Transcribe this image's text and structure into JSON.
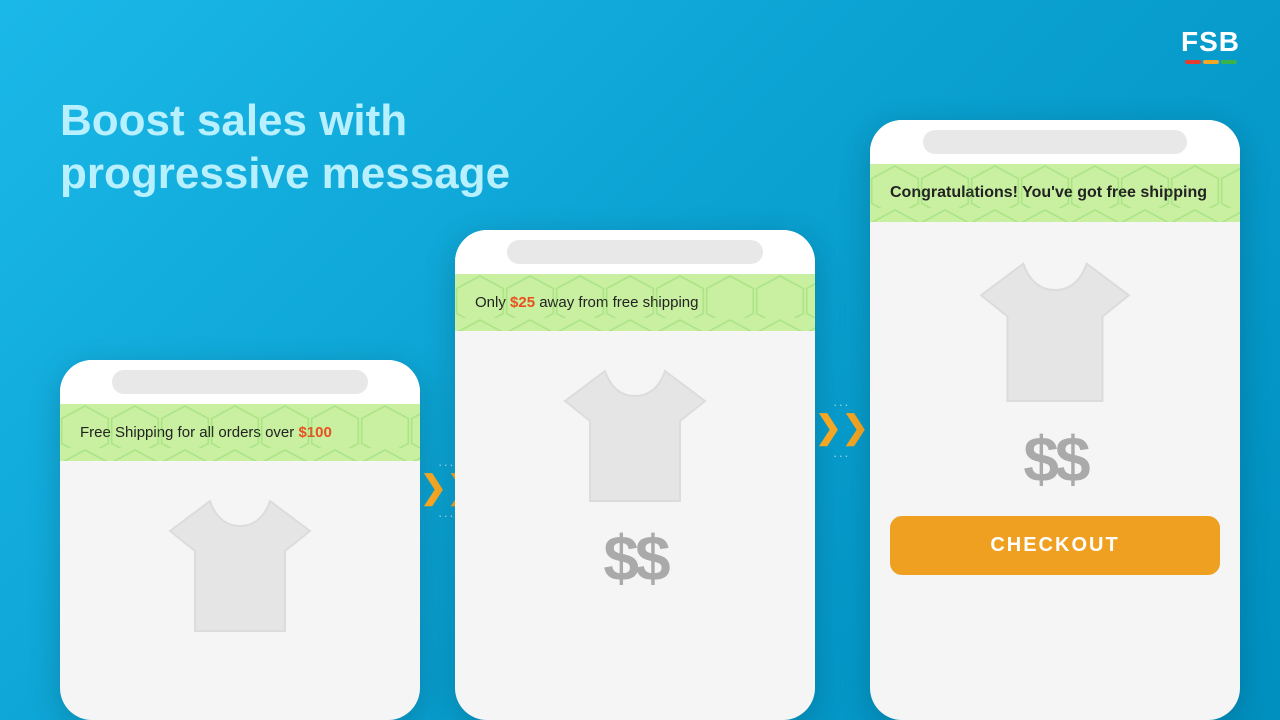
{
  "logo": {
    "text": "FSB",
    "bar_colors": [
      "#e63c2f",
      "#f5a623",
      "#3ab34a"
    ]
  },
  "headline": {
    "line1": "Boost sales with",
    "line2": "progressive message"
  },
  "phone1": {
    "banner_text_before": "Free Shipping for all orders over ",
    "banner_amount": "$100",
    "tshirt_label": "t-shirt product image"
  },
  "phone2": {
    "banner_text_before": "Only ",
    "banner_amount": "$25",
    "banner_text_after": " away from free shipping",
    "tshirt_label": "t-shirt product image",
    "price_label": "$$"
  },
  "phone3": {
    "banner_text": "Congratulations! You've got free shipping",
    "tshirt_label": "t-shirt product image",
    "price_label": "$$",
    "checkout_label": "CHECKOUT"
  },
  "arrows": {
    "chevron": "❯❯",
    "dots": "..."
  }
}
